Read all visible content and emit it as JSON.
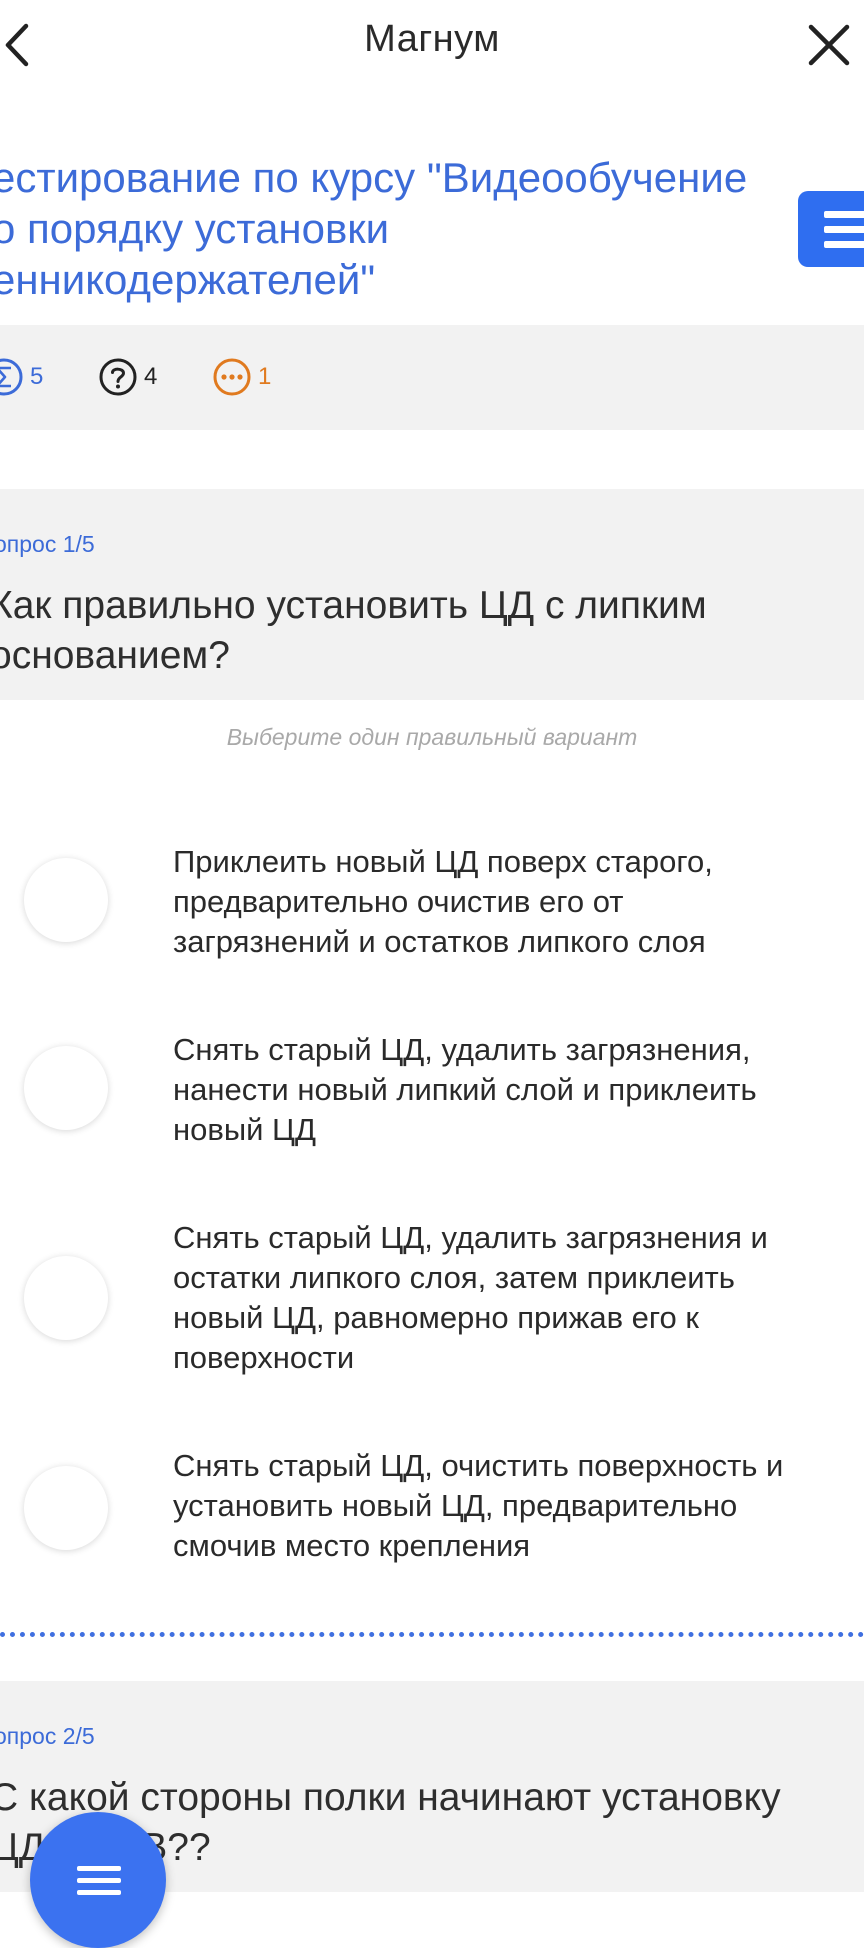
{
  "header": {
    "title": "Магнум"
  },
  "course": {
    "title": "естирование по курсу \"Видеообучение\nо порядку установки\nенникодержателей\""
  },
  "stats": {
    "total": "5",
    "unanswered": "4",
    "pending": "1"
  },
  "questions": [
    {
      "number": "опрос 1/5",
      "text": "Как правильно установить ЦД с липким\nоснованием?",
      "hint": "Выберите один правильный вариант",
      "options": [
        "Приклеить новый ЦД поверх старого,\nпредварительно очистив его от\nзагрязнений и остатков липкого слоя",
        "Снять старый ЦД, удалить загрязнения,\nнанести новый липкий слой и приклеить\nновый ЦД",
        "Снять старый ЦД, удалить загрязнения и\nостатки липкого слоя, затем приклеить\nновый ЦД, равномерно прижав его к\nповерхности",
        "Снять старый ЦД, очистить поверхность и\nустановить новый ЦД, предварительно\nсмочив место крепления"
      ]
    },
    {
      "number": "опрос 2/5",
      "text": "С какой стороны полки начинают установку\nЦД ФРОВ??"
    }
  ],
  "colors": {
    "accent": "#3c6bd8",
    "button": "#2f6ef0",
    "pending": "#e07a1f",
    "card_bg": "#f2f2f2"
  },
  "icons": {
    "back": "chevron-left-icon",
    "close": "close-icon",
    "menu": "hamburger-icon",
    "total": "sigma-circle-icon",
    "unanswered": "question-circle-icon",
    "pending": "ellipsis-circle-icon"
  }
}
